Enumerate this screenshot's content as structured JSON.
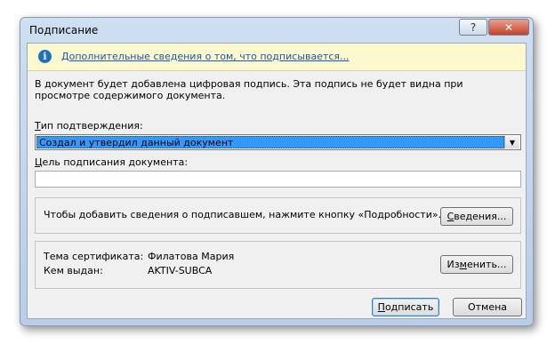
{
  "window": {
    "title": "Подписание",
    "help_glyph": "?",
    "close_glyph": "✕"
  },
  "infobar": {
    "icon": "info-icon",
    "icon_glyph": "i",
    "link": "Дополнительные сведения о том, что подписывается..."
  },
  "description": "В документ будет добавлена цифровая подпись. Эта подпись не будет видна при просмотре содержимого документа.",
  "commitment": {
    "label_access": "Т",
    "label_rest": "ип подтверждения:",
    "selected": "Создал и утвердил данный документ",
    "arrow_glyph": "▼"
  },
  "purpose": {
    "label_access": "Ц",
    "label_rest": "ель подписания документа:",
    "value": ""
  },
  "details_group": {
    "text": "Чтобы добавить сведения о подписавшем, нажмите кнопку «Подробности».",
    "button_access": "С",
    "button_rest": "ведения..."
  },
  "certificate": {
    "subject_label": "Тема сертификата:",
    "subject_value": "Филатова Мария",
    "issuer_label": "Кем выдан:",
    "issuer_value": "AKTIV-SUBCA",
    "change_button_pre": "Из",
    "change_button_access": "м",
    "change_button_post": "енить..."
  },
  "footer": {
    "sign_access": "П",
    "sign_rest": "одписать",
    "cancel_label": "Отмена"
  },
  "colors": {
    "selection": "#3399ff",
    "link": "#1a56b0",
    "infobar_bg": "#fdf9cf",
    "close_button": "#c3422c"
  }
}
